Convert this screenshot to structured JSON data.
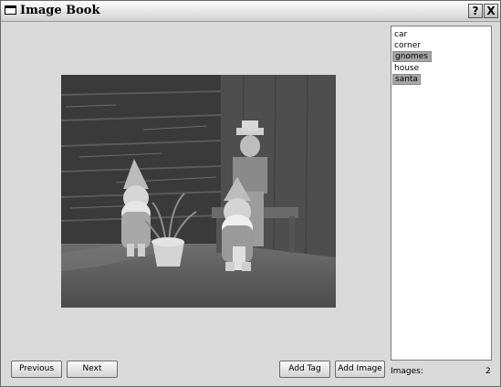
{
  "window": {
    "title": "Image Book",
    "help_button": "?",
    "close_button": "X"
  },
  "image": {
    "icon": "photo-of-garden-gnomes-icon"
  },
  "tags": {
    "items": [
      {
        "label": "car",
        "selected": false
      },
      {
        "label": "corner",
        "selected": false
      },
      {
        "label": "gnomes",
        "selected": true
      },
      {
        "label": "house",
        "selected": false
      },
      {
        "label": "santa",
        "selected": true
      }
    ]
  },
  "buttons": {
    "previous": "Previous",
    "next": "Next",
    "add_tag": "Add Tag",
    "add_image": "Add Image"
  },
  "status": {
    "images_label": "Images:",
    "images_count": "2"
  },
  "colors": {
    "selection": "#a6a6a6",
    "window_bg": "#dadada"
  }
}
